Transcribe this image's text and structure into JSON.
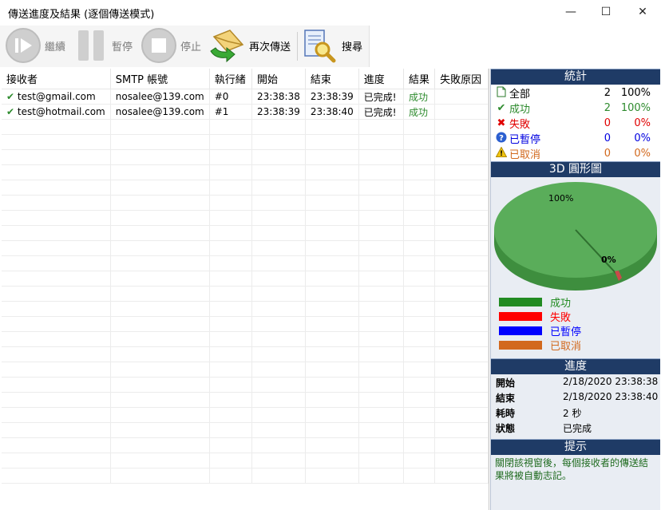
{
  "window": {
    "title": "傳送進度及結果 (逐個傳送模式)",
    "minimize_glyph": "—",
    "maximize_glyph": "☐",
    "close_glyph": "✕"
  },
  "toolbar": {
    "continue_label": "繼續",
    "pause_label": "暫停",
    "stop_label": "停止",
    "resend_label": "再次傳送",
    "search_label": "搜尋"
  },
  "table": {
    "columns": [
      "接收者",
      "SMTP 帳號",
      "執行緒",
      "開始",
      "結束",
      "進度",
      "結果",
      "失敗原因"
    ],
    "rows": [
      {
        "recipient": "test@gmail.com",
        "smtp": "nosalee@139.com",
        "thread": "#0",
        "start": "23:38:38",
        "end": "23:38:39",
        "progress": "已完成!",
        "result": "成功",
        "reason": ""
      },
      {
        "recipient": "test@hotmail.com",
        "smtp": "nosalee@139.com",
        "thread": "#1",
        "start": "23:38:39",
        "end": "23:38:40",
        "progress": "已完成!",
        "result": "成功",
        "reason": ""
      }
    ]
  },
  "stats": {
    "header": "統計",
    "rows": [
      {
        "label": "全部",
        "count": "2",
        "percent": "100%",
        "color": "#000000",
        "icon": "document-icon"
      },
      {
        "label": "成功",
        "count": "2",
        "percent": "100%",
        "color": "#2e8b2e",
        "icon": "check-icon"
      },
      {
        "label": "失敗",
        "count": "0",
        "percent": "0%",
        "color": "#e00000",
        "icon": "x-icon"
      },
      {
        "label": "已暫停",
        "count": "0",
        "percent": "0%",
        "color": "#0000e0",
        "icon": "question-icon"
      },
      {
        "label": "已取消",
        "count": "0",
        "percent": "0%",
        "color": "#d2691e",
        "icon": "warning-icon"
      }
    ]
  },
  "pie": {
    "header": "3D 圓形圖",
    "label_main": "100%",
    "label_zero": "0%"
  },
  "legend": [
    {
      "label": "成功",
      "color": "#228b22"
    },
    {
      "label": "失敗",
      "color": "#ff0000"
    },
    {
      "label": "已暫停",
      "color": "#0000ff"
    },
    {
      "label": "已取消",
      "color": "#d2691e"
    }
  ],
  "progress": {
    "header": "進度",
    "rows": [
      {
        "key": "開始",
        "value": "2/18/2020 23:38:38"
      },
      {
        "key": "結束",
        "value": "2/18/2020 23:38:40"
      },
      {
        "key": "耗時",
        "value": "2 秒"
      },
      {
        "key": "狀態",
        "value": "已完成"
      }
    ]
  },
  "tips": {
    "header": "提示",
    "text": "關閉該視窗後，每個接收者的傳送結果將被自動志記。"
  },
  "colors": {
    "header_bg": "#1f3b66",
    "panel_bg": "#e9edf3",
    "success": "#2e8b2e"
  }
}
